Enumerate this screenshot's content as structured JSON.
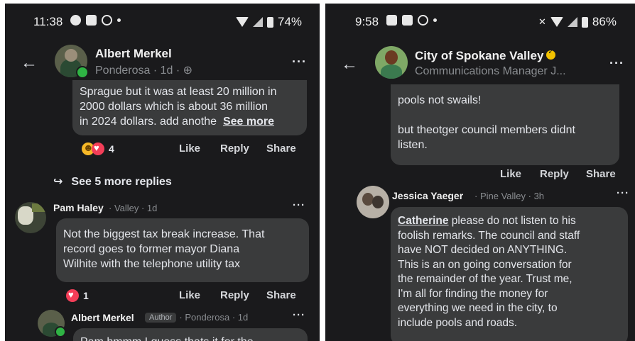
{
  "left": {
    "status": {
      "time": "11:38",
      "battery": "74%"
    },
    "post_author": {
      "name": "Albert Merkel",
      "meta": "Ponderosa · 1d · ⊕"
    },
    "post_comment": {
      "lines": [
        "Sprague but it was at least 20 million in",
        "2000 dollars which is about 36 million",
        "in 2024 dollars. add anothe"
      ],
      "see_more": "See more",
      "reaction_count": "4"
    },
    "actions": {
      "like": "Like",
      "reply": "Reply",
      "share": "Share"
    },
    "see_more_replies": "See 5 more replies",
    "reply1": {
      "name": "Pam Haley",
      "meta": "· Valley · 1d",
      "lines": [
        "Not the biggest tax break increase.  That",
        "record goes to former mayor Diana",
        "Wilhite with the telephone utility tax"
      ],
      "reaction_count": "1"
    },
    "reply2": {
      "name": "Albert Merkel",
      "author_tag": "Author",
      "meta": "· Ponderosa · 1d",
      "partial_text": "Pam hmmm I guess thats it for the"
    }
  },
  "right": {
    "status": {
      "time": "9:58",
      "battery": "86%"
    },
    "page": {
      "name": "City of Spokane Valley",
      "subtitle": "Communications Manager J..."
    },
    "comment": {
      "lines_a": [
        "pools not swails!"
      ],
      "lines_b": [
        "but theotger council members didnt",
        "listen."
      ]
    },
    "actions": {
      "like": "Like",
      "reply": "Reply",
      "share": "Share"
    },
    "reply": {
      "name": "Jessica Yaeger",
      "meta": "· Pine Valley · 3h",
      "mention": "Catherine",
      "first_line_rest": " please do not listen to his",
      "lines": [
        "foolish remarks.  The council and staff",
        "have NOT decided on ANYTHING.",
        "This is an on going conversation for",
        "the remainder of the year.  Trust me,",
        "I'm all for finding the money for",
        "everything we need in the city, to",
        "include pools and roads."
      ]
    }
  },
  "colors": {
    "background": "#1a1a1c",
    "bubble": "#3a3b3c",
    "muted": "#8a8d91",
    "green": "#2fb344",
    "verified": "#f2c200"
  }
}
